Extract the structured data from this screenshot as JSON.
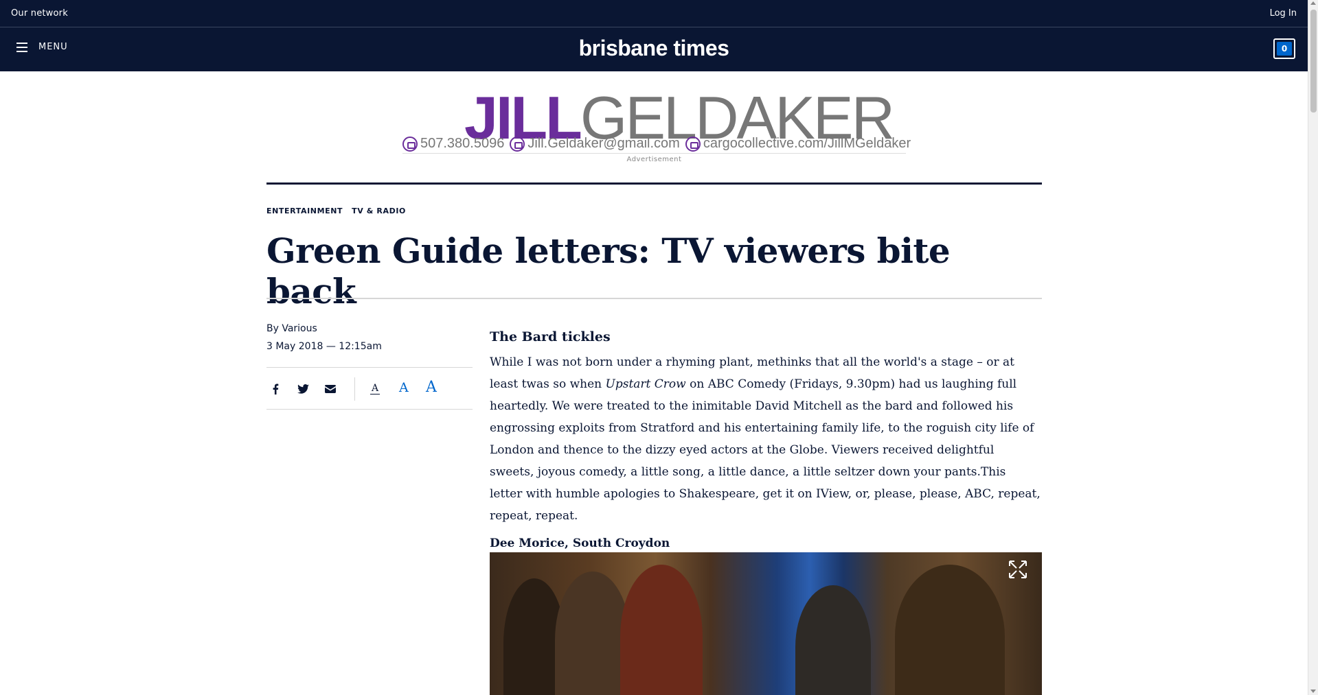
{
  "topbar": {
    "network_label": "Our network",
    "login_label": "Log In"
  },
  "header": {
    "menu_label": "MENU",
    "brand": "brisbane times",
    "cart_count": "0"
  },
  "ad": {
    "logo_first": "JILL",
    "logo_last": "GELDAKER",
    "phone": "507.380.5096",
    "email": "Jill.Geldaker@gmail.com",
    "website": "cargocollective.com/JillMGeldaker",
    "label": "Advertisement",
    "colors": {
      "accent": "#6a2d9b",
      "gray": "#777777"
    }
  },
  "article": {
    "categories": [
      "ENTERTAINMENT",
      "TV & RADIO"
    ],
    "headline": "Green Guide letters: TV viewers bite back",
    "byline": "By Various",
    "date": "3 May 2018 — 12:15am",
    "share_icons": [
      "facebook-icon",
      "twitter-icon",
      "email-icon"
    ],
    "font_size_labels": [
      "A",
      "A",
      "A"
    ],
    "subhead": "The Bard tickles",
    "para_lead": "While I was not born under a rhyming plant, methinks that all the world's a stage – or at least twas so when ",
    "para_italic": "Upstart Crow",
    "para_rest": " on ABC Comedy (Fridays, 9.30pm) had us laughing full heartedly. We were treated to the inimitable David Mitchell as the bard and followed his engrossing exploits from Stratford and his entertaining family life, to the roguish city life of London and thence to the dizzy eyed actors at the Globe. Viewers received delightful sweets, joyous comedy, a little song, a little dance, a little seltzer down your pants.This letter with humble apologies to Shakespeare, get it on IView, or, please, please, ABC, repeat, repeat, repeat.",
    "signoff": "Dee Morice, South Croydon"
  },
  "colors": {
    "navy": "#0a1633",
    "link_blue": "#0066cc",
    "rule_gray": "#d6d6d6"
  }
}
